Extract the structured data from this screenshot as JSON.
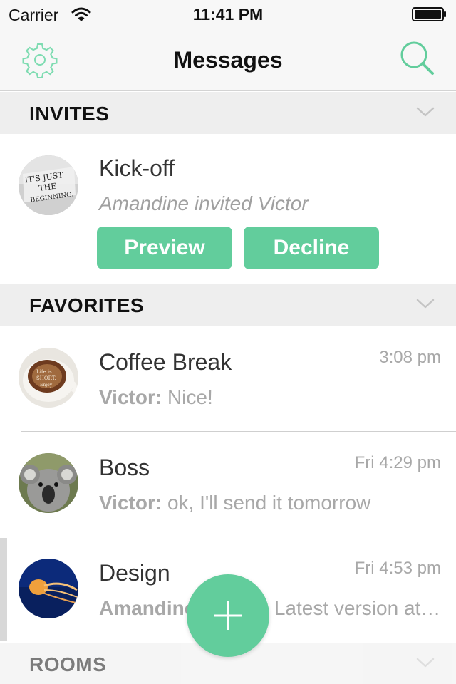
{
  "status_bar": {
    "carrier": "Carrier",
    "time": "11:41 PM",
    "wifi_icon": "wifi-icon",
    "battery_icon": "battery-icon"
  },
  "nav": {
    "title": "Messages",
    "left_icon": "gear-icon",
    "right_icon": "search-icon"
  },
  "sections": {
    "invites": "INVITES",
    "favorites": "FAVORITES",
    "rooms": "ROOMS"
  },
  "invite": {
    "name": "Kick-off",
    "subtitle": "Amandine invited Victor",
    "preview_label": "Preview",
    "decline_label": "Decline",
    "avatar_text": "IT'S JUST THE BEGINNING."
  },
  "favorites": [
    {
      "name": "Coffee Break",
      "time": "3:08 pm",
      "sender": "Victor:",
      "message": " Nice!"
    },
    {
      "name": "Boss",
      "time": "Fri 4:29 pm",
      "sender": "Victor:",
      "message": " ok, I'll send it tomorrow"
    },
    {
      "name": "Design",
      "time": "Fri 4:53 pm",
      "sender": "Amandine:",
      "message": " Alright! Latest version attached"
    }
  ],
  "colors": {
    "accent": "#62cd9c",
    "header_bg": "#eeeeee",
    "nav_bg": "#f7f7f7",
    "muted_text": "#a8a8a8"
  },
  "fab_icon": "plus-icon"
}
